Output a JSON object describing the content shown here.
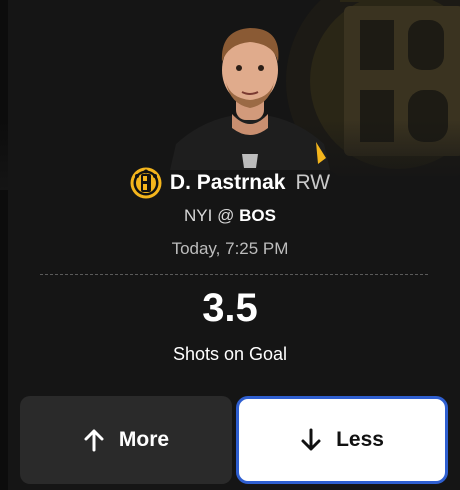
{
  "player": {
    "name": "D. Pastrnak",
    "position": "RW"
  },
  "matchup": {
    "away": "NYI",
    "separator": "@",
    "home": "BOS"
  },
  "game_time": "Today, 7:25 PM",
  "line": {
    "value": "3.5",
    "stat": "Shots on Goal"
  },
  "buttons": {
    "more_label": "More",
    "less_label": "Less"
  },
  "icons": {
    "team_logo": "bruins-logo-icon",
    "more": "arrow-up-icon",
    "less": "arrow-down-icon"
  },
  "colors": {
    "background": "#151515",
    "more_button": "#2a2a2a",
    "less_button": "#ffffff",
    "selected_border": "#2f5fd0",
    "team_gold": "#f4b51c"
  }
}
